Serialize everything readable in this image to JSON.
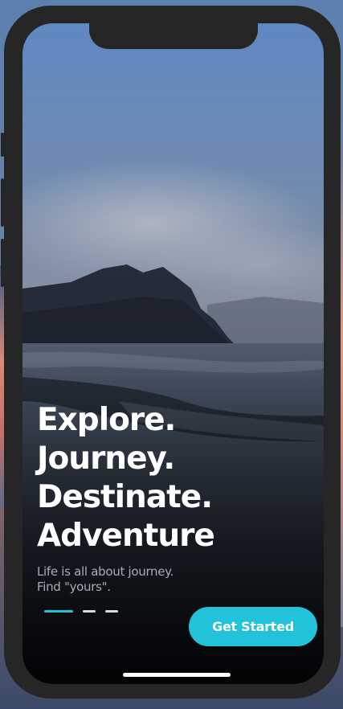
{
  "onboarding": {
    "headline_lines": [
      "Explore.",
      "Journey.",
      "Destinate.",
      "Adventure"
    ],
    "subtitle_lines": [
      "Life is all about journey.",
      "Find \"yours\"."
    ],
    "page_indicator": {
      "total": 3,
      "current": 1
    },
    "cta_label": "Get Started"
  },
  "colors": {
    "accent": "#22c3da",
    "phone_frame": "#262626",
    "headline_text": "#ffffff",
    "subtitle_text": "#a9adb3"
  },
  "icons": {
    "background": "mountain-coast-photo"
  }
}
